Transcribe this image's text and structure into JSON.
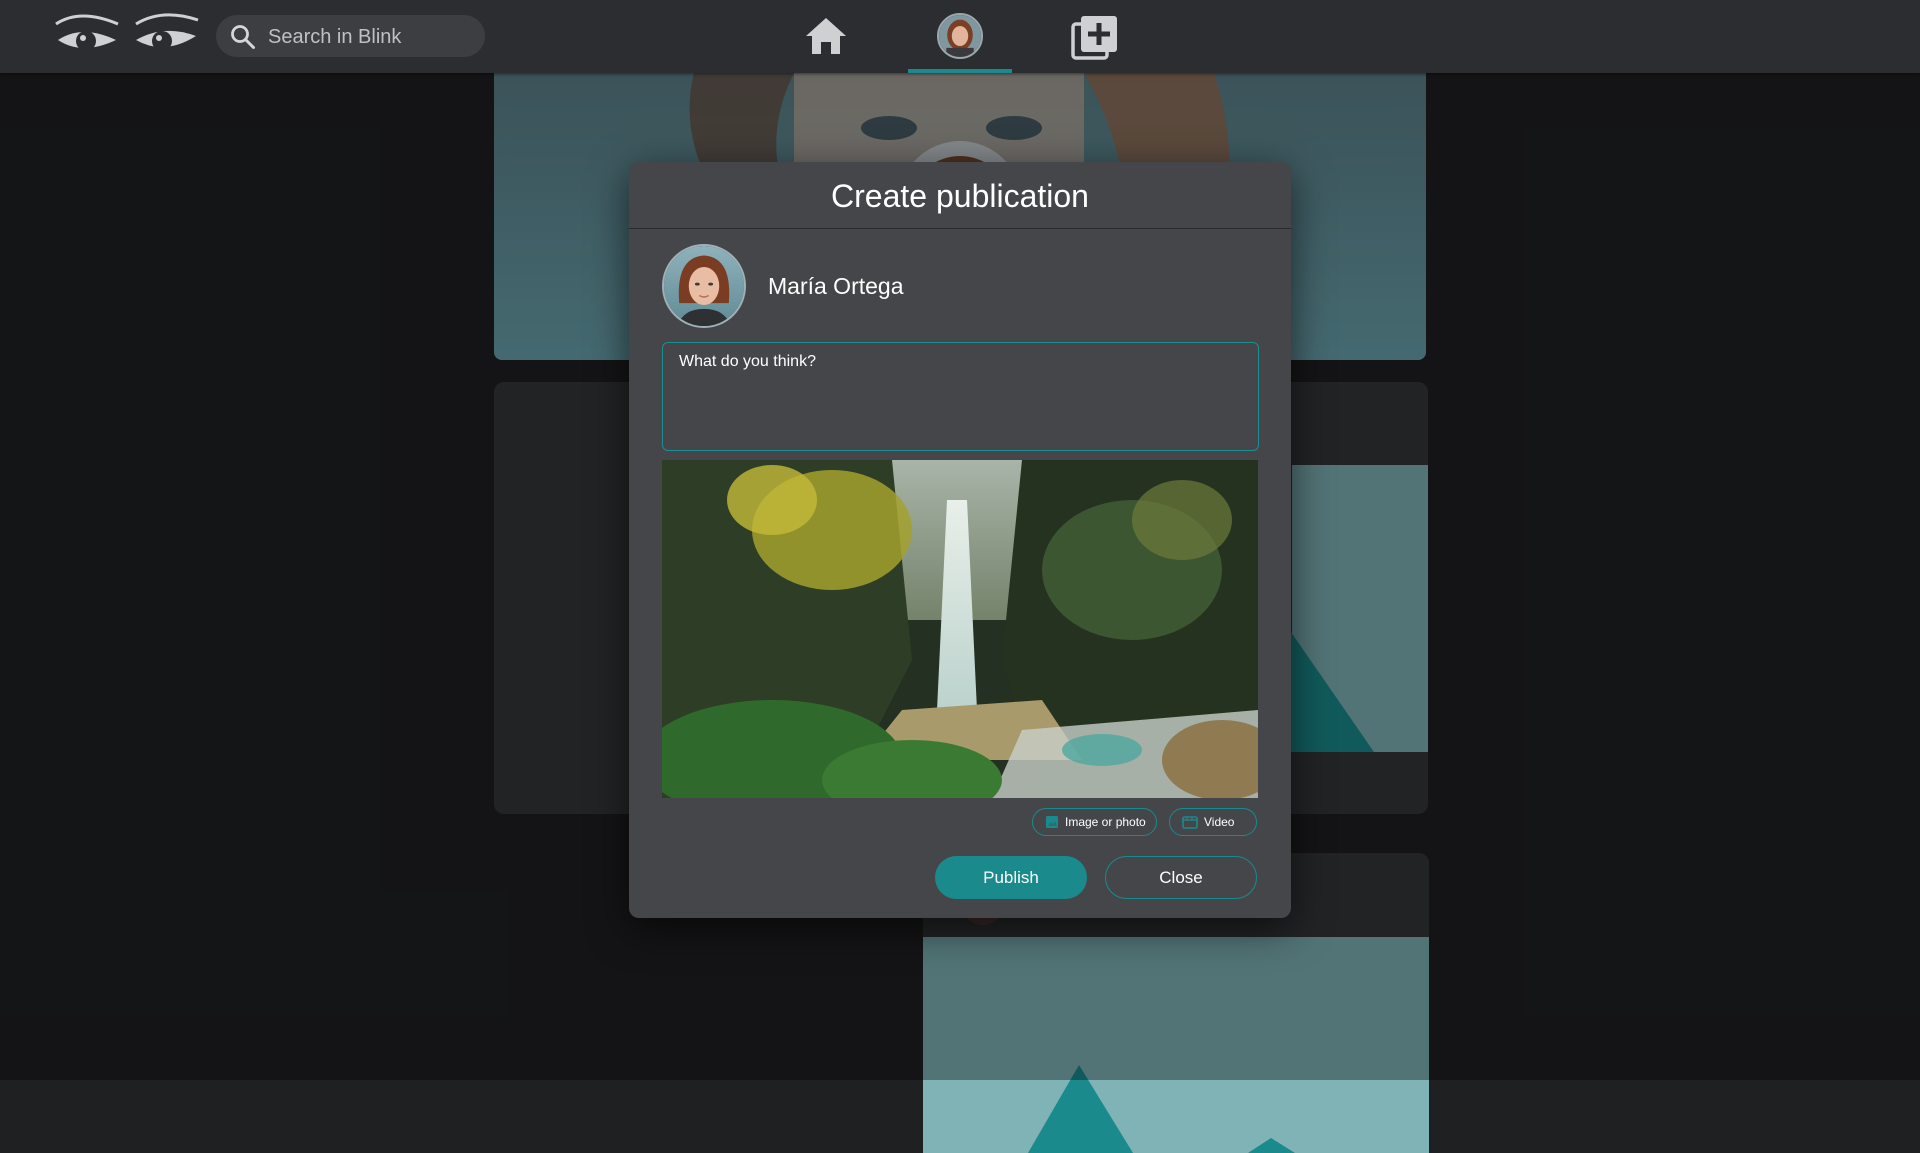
{
  "app": {
    "logo_icon": "eyes-logo-icon"
  },
  "search": {
    "placeholder": "Search in Blink",
    "icon": "search-icon"
  },
  "nav": {
    "home_icon": "home-icon",
    "profile_icon": "profile-avatar",
    "create_icon": "add-post-icon",
    "active_item": "profile"
  },
  "modal": {
    "title": "Create publication",
    "author": {
      "name": "María Ortega"
    },
    "input": {
      "value": "What do you think?"
    },
    "attachments": {
      "image_label": "Image or photo",
      "video_label": "Video"
    },
    "actions": {
      "publish_label": "Publish",
      "close_label": "Close"
    }
  },
  "colors": {
    "accent": "#1b8a8c",
    "topbar": "#2c2d30",
    "modal": "#45464a",
    "page_background": "#1f2022"
  }
}
